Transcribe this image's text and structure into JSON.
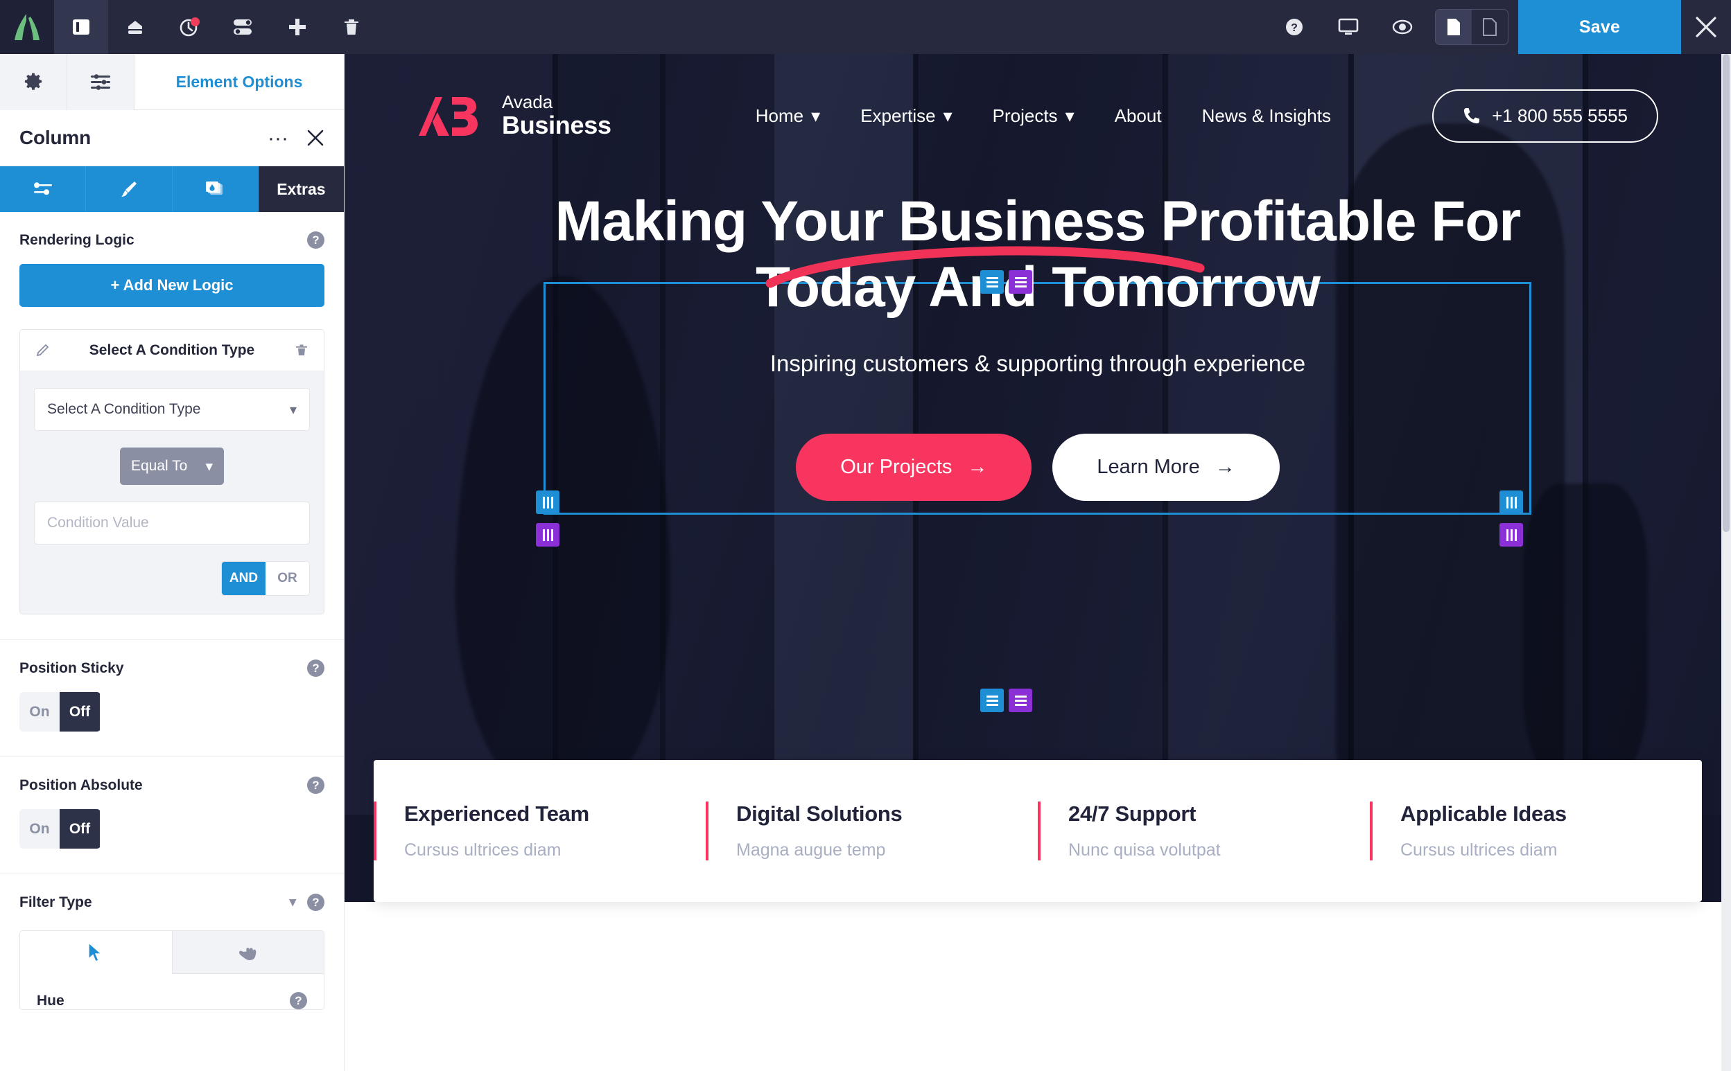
{
  "topbar": {
    "logo_icon": "avada-logo-icon",
    "buttons": [
      {
        "name": "layout-panel-icon",
        "active": true
      },
      {
        "name": "library-icon",
        "active": false
      },
      {
        "name": "history-clock-icon",
        "active": false,
        "badge": true
      },
      {
        "name": "toggles-icon",
        "active": false
      },
      {
        "name": "add-element-icon",
        "active": false
      },
      {
        "name": "trash-icon",
        "active": false
      }
    ],
    "right_buttons": [
      {
        "name": "help-icon"
      },
      {
        "name": "responsive-desktop-icon"
      },
      {
        "name": "preview-eye-icon"
      }
    ],
    "doc_group": [
      {
        "name": "page-filled-icon",
        "active": true
      },
      {
        "name": "page-outline-icon",
        "active": false
      }
    ],
    "save_label": "Save",
    "close_icon": "close-icon"
  },
  "panel": {
    "top_tabs": [
      {
        "name": "gear-icon"
      },
      {
        "name": "sliders-icon"
      }
    ],
    "element_options_label": "Element Options",
    "title": "Column",
    "more_label": "···",
    "close_icon": "close-icon",
    "subtabs": [
      {
        "name": "sliders-icon",
        "label": ""
      },
      {
        "name": "brush-icon",
        "label": ""
      },
      {
        "name": "background-layers-icon",
        "label": ""
      },
      {
        "name": "extras-tab",
        "label": "Extras"
      }
    ],
    "rendering_logic": {
      "heading": "Rendering Logic",
      "add_button_label": "+ Add New Logic",
      "condition_card": {
        "title": "Select A Condition Type",
        "type_select_value": "Select A Condition Type",
        "operator_value": "Equal To",
        "value_placeholder": "Condition Value",
        "logic_and": "AND",
        "logic_or": "OR",
        "logic_selected": "AND"
      }
    },
    "position_sticky": {
      "heading": "Position Sticky",
      "on_label": "On",
      "off_label": "Off",
      "selected": "Off"
    },
    "position_absolute": {
      "heading": "Position Absolute",
      "on_label": "On",
      "off_label": "Off",
      "selected": "Off"
    },
    "filter_type": {
      "heading": "Filter Type",
      "tabs": [
        {
          "name": "cursor-arrow-tab",
          "selected": true
        },
        {
          "name": "hand-pointer-tab",
          "selected": false
        }
      ],
      "hue_label": "Hue"
    }
  },
  "site": {
    "brand": {
      "mark_icon": "ab-monogram-icon",
      "line1": "Avada",
      "line2": "Business"
    },
    "nav": [
      {
        "label": "Home",
        "caret": true
      },
      {
        "label": "Expertise",
        "caret": true
      },
      {
        "label": "Projects",
        "caret": true
      },
      {
        "label": "About",
        "caret": false
      },
      {
        "label": "News & Insights",
        "caret": false
      }
    ],
    "phone": {
      "icon": "phone-icon",
      "number": "+1 800 555 5555"
    },
    "hero": {
      "headline_line1": "Making Your Business Profitable For",
      "headline_line2": "Today And Tomorrow",
      "subheadline": "Inspiring customers & supporting through experience",
      "cta_primary": "Our Projects",
      "cta_secondary": "Learn More",
      "arrow_glyph": "→"
    },
    "features": [
      {
        "title": "Experienced Team",
        "subtitle": "Cursus ultrices diam"
      },
      {
        "title": "Digital Solutions",
        "subtitle": "Magna augue temp"
      },
      {
        "title": "24/7 Support",
        "subtitle": "Nunc quisa volutpat"
      },
      {
        "title": "Applicable Ideas",
        "subtitle": "Cursus ultrices diam"
      }
    ]
  },
  "colors": {
    "accent_blue": "#1e8fd5",
    "accent_purple": "#8b2fd6",
    "brand_red": "#f8355e",
    "dark_navy": "#272a3f",
    "panel_grey": "#f2f3f7"
  }
}
